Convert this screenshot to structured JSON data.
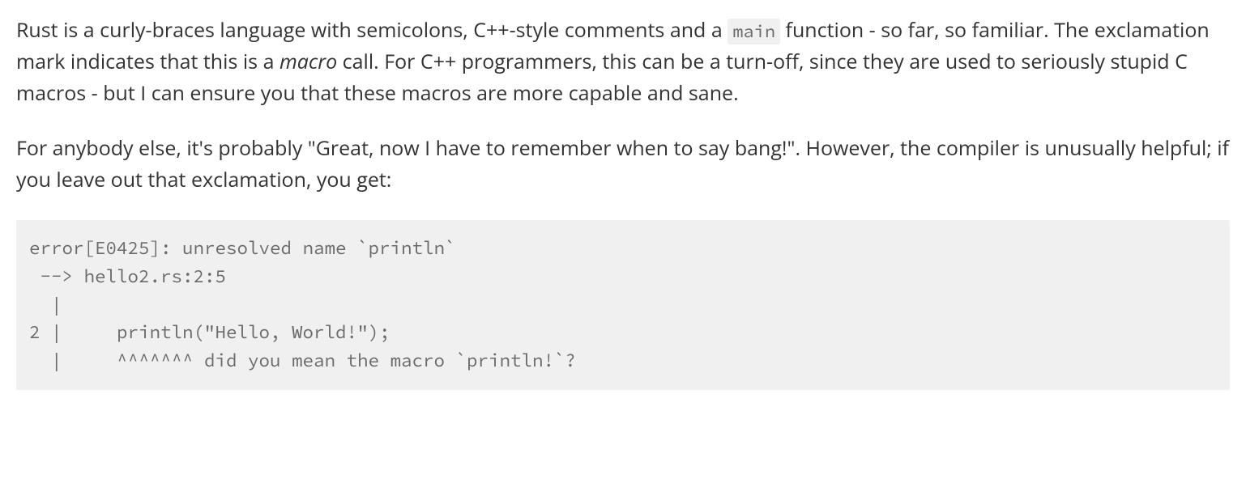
{
  "paragraphs": {
    "p1": {
      "prefix": "Rust is a curly-braces language with semicolons, C++-style comments and a ",
      "code": "main",
      "mid1": " function - so far, so familiar. The exclamation mark indicates that this is a ",
      "em": "macro",
      "suffix": " call. For C++ programmers, this can be a turn-off, since they are used to seriously stupid C macros - but I can ensure you that these macros are more capable and sane."
    },
    "p2": "For anybody else, it's probably \"Great, now I have to remember when to say bang!\". However, the compiler is unusually helpful; if you leave out that exclamation, you get:"
  },
  "code_block": "error[E0425]: unresolved name `println`\n --> hello2.rs:2:5\n  |\n2 |     println(\"Hello, World!\");\n  |     ^^^^^^^ did you mean the macro `println!`?\n"
}
